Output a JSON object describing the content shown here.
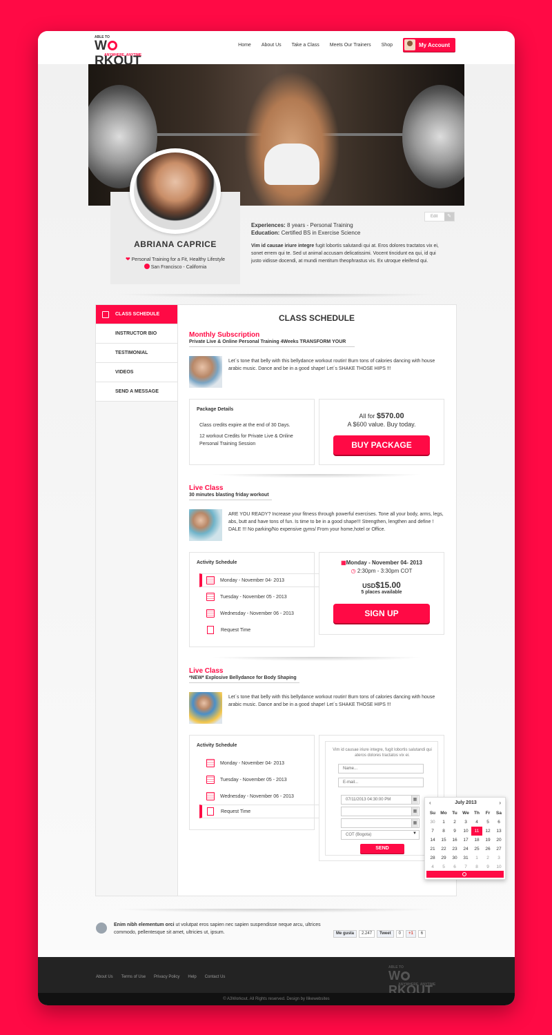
{
  "brand": {
    "small": "ABLE TO",
    "big_prefix": "W",
    "big_suffix": "RKOUT",
    "tagline": "ANYWHERE, ANYTIME",
    "accent": "#ff0a45"
  },
  "nav": {
    "items": [
      "Home",
      "About Us",
      "Take a Class",
      "Meets Our Trainers",
      "Shop"
    ],
    "account_label": "My Account"
  },
  "profile": {
    "name": "ABRIANA CAPRICE",
    "tagline": "Personal Training for a Fit, Healthy Lifestyle",
    "location": "San Francisco - California",
    "experiences_label": "Experiences:",
    "experiences_value": " 8 years - Personal Training",
    "education_label": "Education:",
    "education_value": " Certified BS in Exercise Science",
    "bio_bold": "Vim id causae iriure integre",
    "bio_text": " fugit lobortis salutandi qui at. Eros dolores tractatos vix ei, sonet errem qui te. Sed ut animal accusam delicatissimi. Vocent tincidunt ea qui, id qui justo vidisse docendi, at mundi mentitum theophrastus vis. Ex utroque eleifend qui.",
    "edit_label": "Edit"
  },
  "sidebar": {
    "items": [
      "CLASS SCHEDULE",
      "INSTRUCTOR BIO",
      "TESTIMONIAL",
      "VIDEOS",
      "SEND A MESSAGE"
    ]
  },
  "schedule": {
    "title": "CLASS SCHEDULE",
    "sub1": {
      "heading": "Monthly Subscription",
      "subheading": "Private Live & Online Personal Training 4Weeks TRANSFORM YOUR",
      "description": "Let´s tone that belly with this bellydance workout routin! Burn tons of calories dancing with house arabic music. Dance and be in a good shape! Let´s SHAKE THOSE HIPS !!!",
      "package_title": "Package Details",
      "package_line1": "Class credits expire at the end of 30 Days.",
      "package_line2": "12 workout Credits for Private Live & Online Personal Training Session",
      "price_prefix": "All for ",
      "price": "$570.00",
      "value_text": "A $600 value. Buy today.",
      "button": "BUY PACKAGE"
    },
    "sub2": {
      "heading": "Live Class",
      "subheading": "30 minutes blasting friday workout",
      "description": "ARE YOU READY? Increase your fitness through powerful exercises. Tone all your body, arms, legs, abs, butt and have tons of fun. Is time to be in a good shape!!! Strengthen, lengthen and define ! DALE !!! No parking/No expensive gyms/ From your home,hotel or Office.",
      "activity_title": "Activity Schedule",
      "dates": [
        "Monday - November 04- 2013",
        "Tuesday - November 05 - 2013",
        "Wednesday - November 06 - 2013",
        "Request Time"
      ],
      "selected_date": "Monday - November 04- 2013",
      "selected_time": "2:30pm - 3:30pm COT",
      "currency": "USD",
      "price": "$15.00",
      "places": "5 places available",
      "button": "SIGN UP"
    },
    "sub3": {
      "heading": "Live Class",
      "subheading": "*NEW* Explosive Bellydance for Body Shaping",
      "description": "Let´s tone that belly with this bellydance workout routin! Burn tons of calories dancing with house arabic music. Dance and be in a good shape! Let´s SHAKE THOSE HIPS !!!",
      "activity_title": "Activity Schedule",
      "dates": [
        "Monday - November 04- 2013",
        "Tuesday - November 05 - 2013",
        "Wednesday - November 06 - 2013",
        "Request Time"
      ],
      "form_intro": "Vim id causae iriure integre, fugit lobortis salutandi qui ateros dolores tractatos vix ei.",
      "name_placeholder": "Name...",
      "email_placeholder": "E-mail...",
      "datetime_value": "07/11/2013 04:30:00 PM",
      "timezone_value": "COT (Bogota)",
      "send_button": "SEND"
    }
  },
  "calendar": {
    "month": "July 2013",
    "prev": "‹",
    "next": "›",
    "days_of_week": [
      "Su",
      "Mo",
      "Tu",
      "We",
      "Th",
      "Fr",
      "Sa"
    ],
    "weeks": [
      [
        "30",
        "1",
        "2",
        "3",
        "4",
        "5",
        "6"
      ],
      [
        "7",
        "8",
        "9",
        "10",
        "11",
        "12",
        "13"
      ],
      [
        "14",
        "15",
        "16",
        "17",
        "18",
        "19",
        "20"
      ],
      [
        "21",
        "22",
        "23",
        "24",
        "25",
        "26",
        "27"
      ],
      [
        "28",
        "29",
        "30",
        "31",
        "1",
        "2",
        "3"
      ],
      [
        "4",
        "5",
        "6",
        "7",
        "8",
        "9",
        "10"
      ]
    ],
    "selected": "11"
  },
  "info": {
    "bold": "Enim nibh elementum orci",
    "text": " ut volutpat eros sapien nec sapien suspendisse neque arcu, ultrices commodo, pellentesque sit amet, ultricies ut, ipsum."
  },
  "social": {
    "fb_label": "Me gusta",
    "fb_count": "2.247",
    "tw_label": "Tweet",
    "tw_count": "0",
    "gp_label": "+1",
    "gp_count": "6"
  },
  "footer": {
    "links": [
      "About Us",
      "Terms of Use",
      "Privacy Policy",
      "Help",
      "Contact Us"
    ],
    "copyright": "© A3Workout. All Rights reserved. Design by Ilikewebsites"
  }
}
